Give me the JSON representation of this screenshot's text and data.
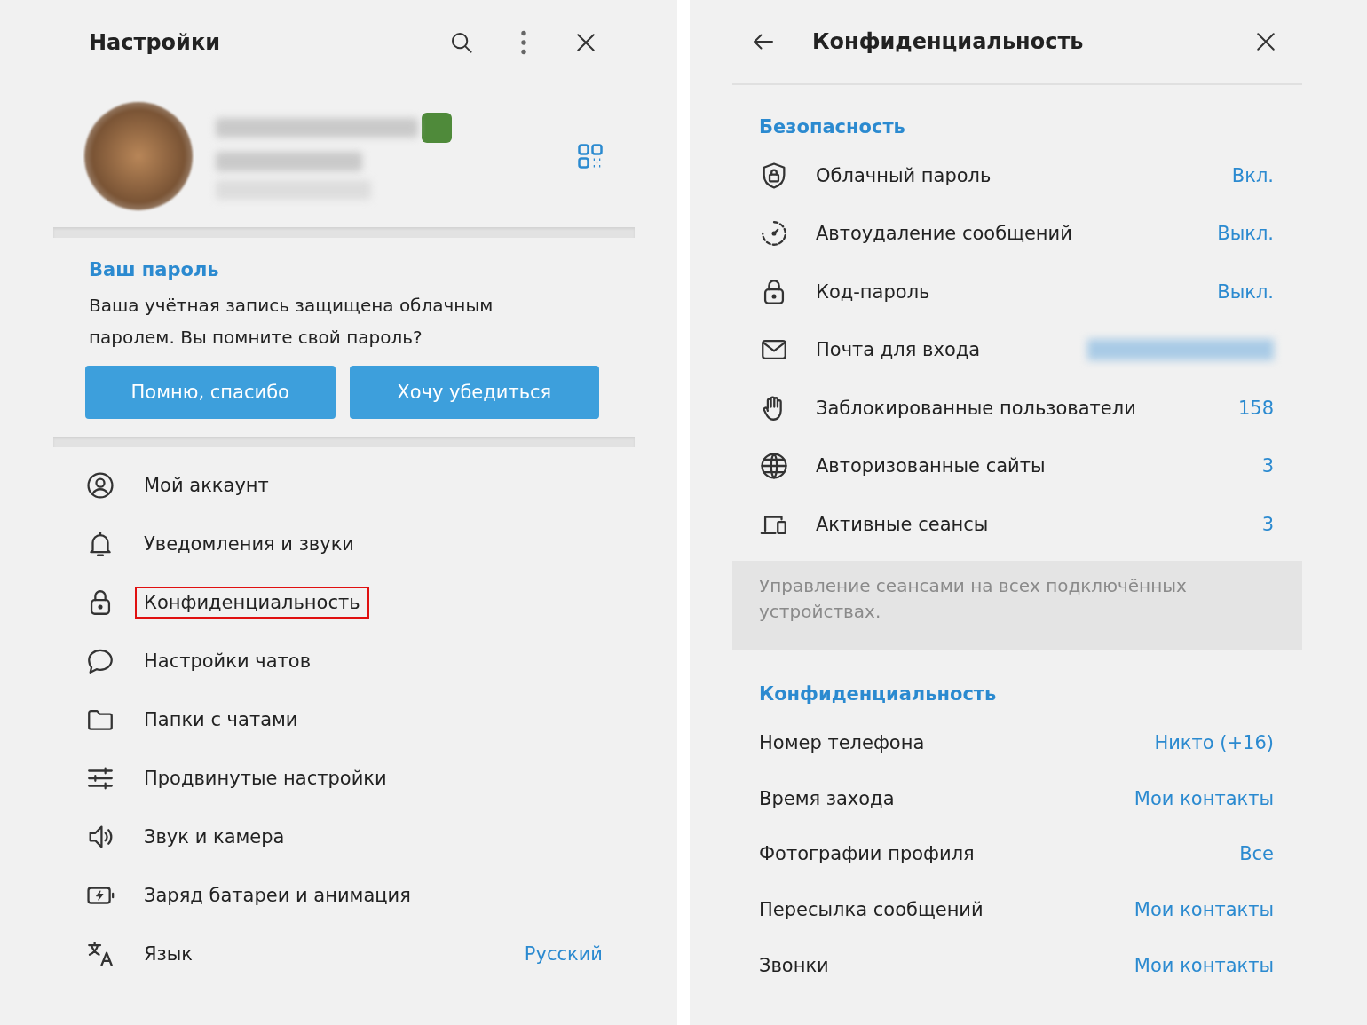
{
  "settings": {
    "title": "Настройки",
    "password_card": {
      "title": "Ваш пароль",
      "text": "Ваша учётная запись защищена облачным паролем. Вы помните свой пароль?",
      "buttons": [
        "Помню, спасибо",
        "Хочу убедиться"
      ]
    },
    "menu": [
      {
        "label": "Мой аккаунт",
        "highlighted": false
      },
      {
        "label": "Уведомления и звуки",
        "highlighted": false
      },
      {
        "label": "Конфиденциальность",
        "highlighted": true
      },
      {
        "label": "Настройки чатов",
        "highlighted": false
      },
      {
        "label": "Папки с чатами",
        "highlighted": false
      },
      {
        "label": "Продвинутые настройки",
        "highlighted": false
      },
      {
        "label": "Звук и камера",
        "highlighted": false
      },
      {
        "label": "Заряд батареи и анимация",
        "highlighted": false
      },
      {
        "label": "Язык",
        "highlighted": false,
        "value": "Русский"
      }
    ]
  },
  "privacy": {
    "title": "Конфиденциальность",
    "security": {
      "title": "Безопасность",
      "rows": [
        {
          "label": "Облачный пароль",
          "value": "Вкл.",
          "blurred": false
        },
        {
          "label": "Автоудаление сообщений",
          "value": "Выкл.",
          "blurred": false
        },
        {
          "label": "Код-пароль",
          "value": "Выкл.",
          "blurred": false
        },
        {
          "label": "Почта для входа",
          "blurred": true
        },
        {
          "label": "Заблокированные пользователи",
          "value": "158",
          "blurred": false
        },
        {
          "label": "Авторизованные сайты",
          "value": "3",
          "blurred": false
        },
        {
          "label": "Активные сеансы",
          "value": "3",
          "blurred": false
        }
      ],
      "note": "Управление сеансами на всех подключённых устройствах."
    },
    "privacy_section": {
      "title": "Конфиденциальность",
      "rows": [
        {
          "label": "Номер телефона",
          "value": "Никто (+16)"
        },
        {
          "label": "Время захода",
          "value": "Мои контакты"
        },
        {
          "label": "Фотографии профиля",
          "value": "Все"
        },
        {
          "label": "Пересылка сообщений",
          "value": "Мои контакты"
        },
        {
          "label": "Звонки",
          "value": "Мои контакты"
        }
      ]
    }
  }
}
